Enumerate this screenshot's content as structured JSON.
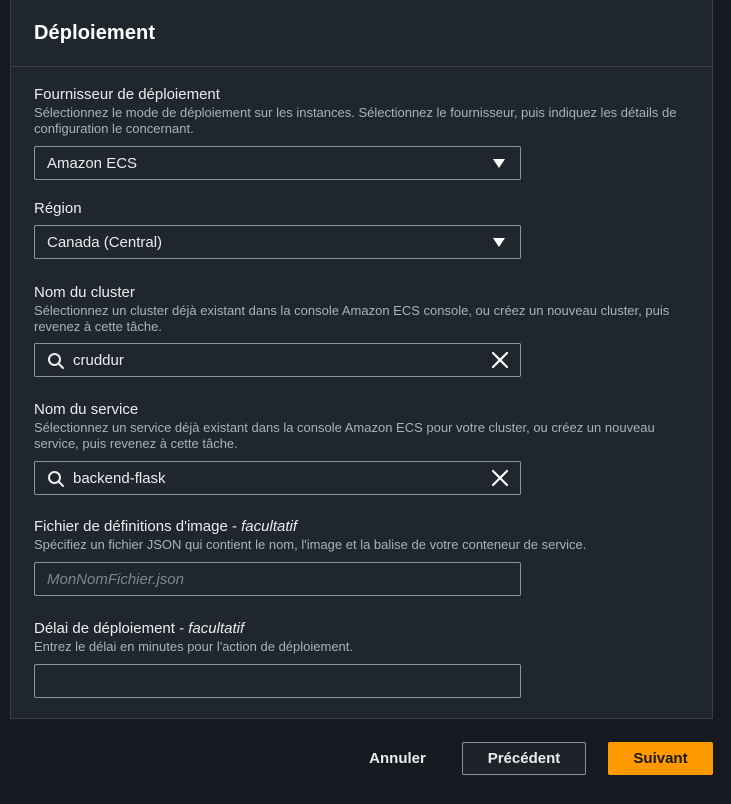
{
  "panel": {
    "title": "Déploiement"
  },
  "provider": {
    "label": "Fournisseur de déploiement",
    "description": "Sélectionnez le mode de déploiement sur les instances. Sélectionnez le fournisseur, puis indiquez les détails de configuration le concernant.",
    "value": "Amazon ECS"
  },
  "region": {
    "label": "Région",
    "value": "Canada (Central)"
  },
  "cluster": {
    "label": "Nom du cluster",
    "description": "Sélectionnez un cluster déjà existant dans la console Amazon ECS console, ou créez un nouveau cluster, puis revenez à cette tâche.",
    "value": "cruddur"
  },
  "service": {
    "label": "Nom du service",
    "description": "Sélectionnez un service déjà existant dans la console Amazon ECS pour votre cluster, ou créez un nouveau service, puis revenez à cette tâche.",
    "value": "backend-flask"
  },
  "image_defs": {
    "label": "Fichier de définitions d'image - ",
    "optional": "facultatif",
    "description": "Spécifiez un fichier JSON qui contient le nom, l'image et la balise de votre conteneur de service.",
    "placeholder": "MonNomFichier.json",
    "value": ""
  },
  "timeout": {
    "label": "Délai de déploiement - ",
    "optional": "facultatif",
    "description": "Entrez le délai en minutes pour l'action de déploiement.",
    "value": ""
  },
  "footer": {
    "cancel": "Annuler",
    "previous": "Précédent",
    "next": "Suivant"
  },
  "colors": {
    "primary_button": "#ff9900",
    "background": "#16191f",
    "panel": "#20262e"
  }
}
